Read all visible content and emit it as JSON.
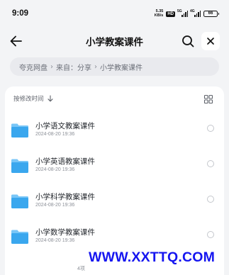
{
  "status_bar": {
    "time": "9:09",
    "net_speed_value": "5.35",
    "net_speed_unit": "KB/s",
    "hd_badge": "HD",
    "signal_1_label": "5G",
    "signal_2_label": "4G",
    "battery_level": "66"
  },
  "header": {
    "title": "小学教案课件",
    "back_icon": "arrow-left-icon",
    "search_icon": "search-icon",
    "close_icon": "close-icon"
  },
  "breadcrumb": {
    "root": "夸克网盘",
    "from": "来自：分享",
    "current": "小学教案课件",
    "separator": "›"
  },
  "list": {
    "sort_label": "按修改时间",
    "sort_icon": "arrow-down-icon",
    "view_icon": "grid-view-icon",
    "items": [
      {
        "name": "小学语文教案课件",
        "date": "2024-08-20 19:36"
      },
      {
        "name": "小学英语教案课件",
        "date": "2024-08-20 19:36"
      },
      {
        "name": "小学科学教案课件",
        "date": "2024-08-20 19:36"
      },
      {
        "name": "小学数学教案课件",
        "date": "2024-08-20 19:36"
      }
    ]
  },
  "footer": {
    "count": "4项"
  },
  "watermark": "WWW.XXTTQ.COM",
  "colors": {
    "folder": "#3aa7ee",
    "folder_tab": "#79c6f7",
    "watermark": "#1515f0"
  }
}
